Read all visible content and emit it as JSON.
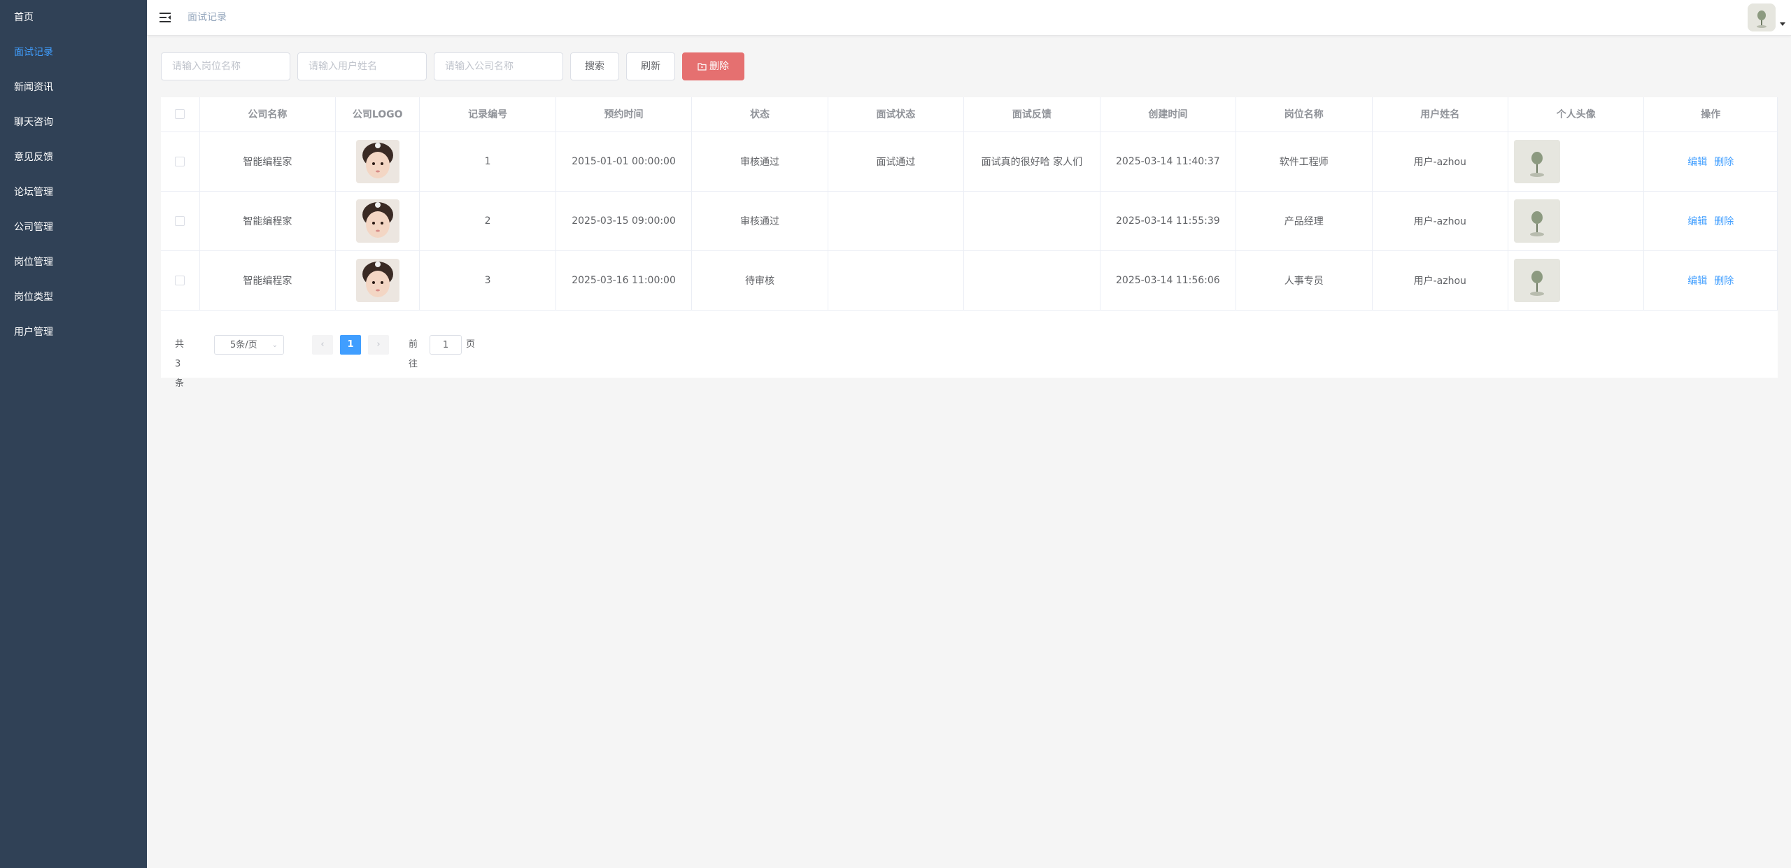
{
  "sidebar": {
    "items": [
      {
        "label": "首页"
      },
      {
        "label": "面试记录"
      },
      {
        "label": "新闻资讯"
      },
      {
        "label": "聊天咨询"
      },
      {
        "label": "意见反馈"
      },
      {
        "label": "论坛管理"
      },
      {
        "label": "公司管理"
      },
      {
        "label": "岗位管理"
      },
      {
        "label": "岗位类型"
      },
      {
        "label": "用户管理"
      }
    ],
    "active_index": 1
  },
  "header": {
    "breadcrumb": "面试记录",
    "menu_icon": "hamburger-icon",
    "avatar_icon": "user-avatar"
  },
  "search": {
    "job_placeholder": "请输入岗位名称",
    "user_placeholder": "请输入用户姓名",
    "company_placeholder": "请输入公司名称",
    "search_label": "搜索",
    "refresh_label": "刷新",
    "delete_label": "删除"
  },
  "table": {
    "headers": [
      "公司名称",
      "公司LOGO",
      "记录编号",
      "预约时间",
      "状态",
      "面试状态",
      "面试反馈",
      "创建时间",
      "岗位名称",
      "用户姓名",
      "个人头像",
      "操作"
    ],
    "rows": [
      {
        "company": "智能编程家",
        "record_no": "1",
        "appointment": "2015-01-01 00:00:00",
        "status": "审核通过",
        "interview_status": "面试通过",
        "feedback": "面试真的很好哈 家人们",
        "created": "2025-03-14 11:40:37",
        "job": "软件工程师",
        "user": "用户-azhou"
      },
      {
        "company": "智能编程家",
        "record_no": "2",
        "appointment": "2025-03-15 09:00:00",
        "status": "审核通过",
        "interview_status": "",
        "feedback": "",
        "created": "2025-03-14 11:55:39",
        "job": "产品经理",
        "user": "用户-azhou"
      },
      {
        "company": "智能编程家",
        "record_no": "3",
        "appointment": "2025-03-16 11:00:00",
        "status": "待审核",
        "interview_status": "",
        "feedback": "",
        "created": "2025-03-14 11:56:06",
        "job": "人事专员",
        "user": "用户-azhou"
      }
    ],
    "edit_label": "编辑",
    "delete_label": "删除"
  },
  "pagination": {
    "total": "共 3 条",
    "page_size": "5条/页",
    "current_page": "1",
    "goto_label": "前往",
    "goto_value": "1",
    "page_suffix": "页"
  },
  "colors": {
    "sidebar_bg": "#304156",
    "accent": "#409eff",
    "danger": "#e57070"
  }
}
